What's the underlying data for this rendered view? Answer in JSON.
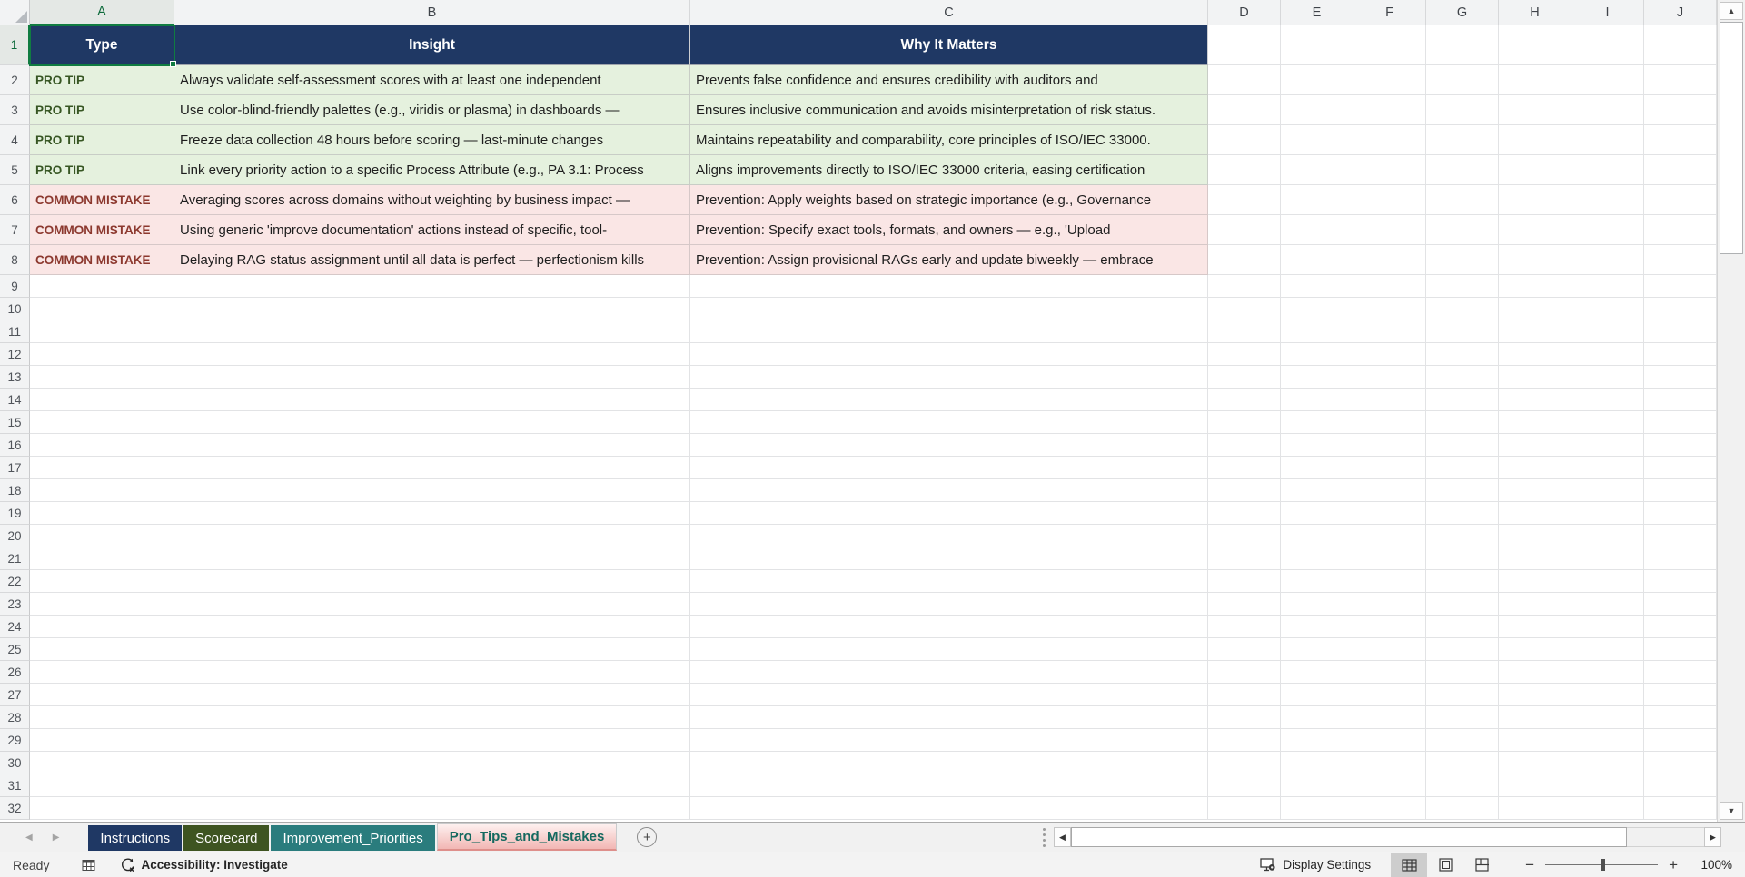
{
  "sheet": {
    "columns": [
      "A",
      "B",
      "C",
      "D",
      "E",
      "F",
      "G",
      "H",
      "I",
      "J"
    ],
    "row_numbers": [
      1,
      2,
      3,
      4,
      5,
      6,
      7,
      8,
      9,
      10,
      11,
      12,
      13,
      14,
      15,
      16,
      17,
      18,
      19,
      20,
      21,
      22,
      23,
      24,
      25,
      26,
      27,
      28,
      29,
      30,
      31,
      32
    ],
    "selected_cell": "A1",
    "table": {
      "headers": [
        "Type",
        "Insight",
        "Why It Matters"
      ],
      "rows": [
        {
          "type": "PRO TIP",
          "category": "tip",
          "insight": "Always validate self-assessment scores with at least one independent",
          "why": "Prevents false confidence and ensures credibility with auditors and"
        },
        {
          "type": "PRO TIP",
          "category": "tip",
          "insight": "Use color-blind-friendly palettes (e.g., viridis or plasma) in dashboards —",
          "why": "Ensures inclusive communication and avoids misinterpretation of risk status."
        },
        {
          "type": "PRO TIP",
          "category": "tip",
          "insight": "Freeze data collection 48 hours before scoring — last-minute changes",
          "why": "Maintains repeatability and comparability, core principles of ISO/IEC 33000."
        },
        {
          "type": "PRO TIP",
          "category": "tip",
          "insight": "Link every priority action to a specific Process Attribute (e.g., PA 3.1: Process",
          "why": "Aligns improvements directly to ISO/IEC 33000 criteria, easing certification"
        },
        {
          "type": "COMMON MISTAKE",
          "category": "mistake",
          "insight": "Averaging scores across domains without weighting by business impact —",
          "why": "Prevention: Apply weights based on strategic importance (e.g., Governance"
        },
        {
          "type": "COMMON MISTAKE",
          "category": "mistake",
          "insight": "Using generic 'improve documentation' actions instead of specific, tool-",
          "why": "Prevention: Specify exact tools, formats, and owners — e.g., 'Upload"
        },
        {
          "type": "COMMON MISTAKE",
          "category": "mistake",
          "insight": "Delaying RAG status assignment until all data is perfect — perfectionism kills",
          "why": "Prevention: Assign provisional RAGs early and update biweekly — embrace"
        }
      ]
    }
  },
  "tabs": {
    "items": [
      {
        "label": "Instructions",
        "style": "navy",
        "active": false
      },
      {
        "label": "Scorecard",
        "style": "green",
        "active": false
      },
      {
        "label": "Improvement_Priorities",
        "style": "teal",
        "active": false
      },
      {
        "label": "Pro_Tips_and_Mistakes",
        "style": "pink",
        "active": true
      }
    ],
    "add_sheet_label": "+"
  },
  "status_bar": {
    "mode": "Ready",
    "accessibility": "Accessibility: Investigate",
    "display_settings": "Display Settings",
    "zoom_level": "100%"
  },
  "colors": {
    "header_fill": "#1F3864",
    "tip_fill": "#E5F1DE",
    "tip_text": "#375623",
    "mistake_fill": "#FAE6E5",
    "mistake_text": "#8C382E",
    "selection_green": "#107C41",
    "tab_navy": "#1F3864",
    "tab_green": "#3E5421",
    "tab_teal": "#2A7C7D",
    "active_tab_text": "#14695F",
    "active_tab_fill": "#F2B7B4"
  }
}
